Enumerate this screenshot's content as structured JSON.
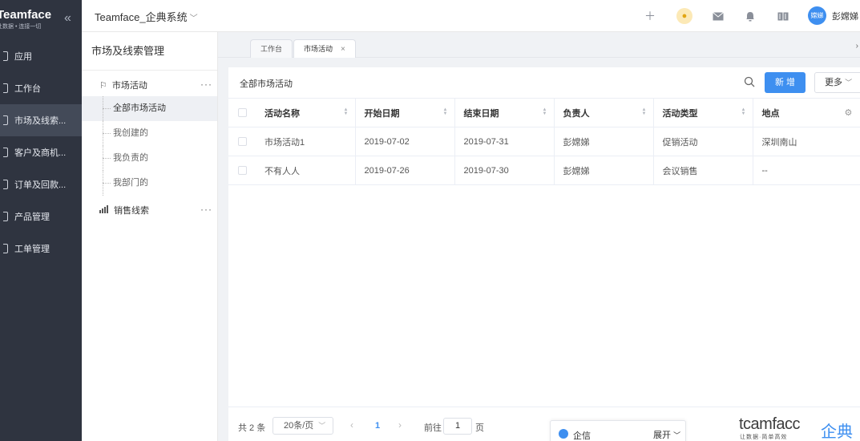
{
  "nav": {
    "brand": "Teamface",
    "slogan": "让数据 • 连接一切",
    "items": [
      {
        "label": "应用",
        "active": false
      },
      {
        "label": "工作台",
        "active": false
      },
      {
        "label": "市场及线索...",
        "active": true
      },
      {
        "label": "客户及商机...",
        "active": false
      },
      {
        "label": "订单及回款...",
        "active": false
      },
      {
        "label": "产品管理",
        "active": false
      },
      {
        "label": "工单管理",
        "active": false
      }
    ]
  },
  "topbar": {
    "title": "Teamface_企典系统",
    "avatar_text": "嫦娣",
    "user_name": "彭嫦娣"
  },
  "subnav": {
    "title": "市场及线索管理",
    "group1": {
      "label": "市场活动",
      "more": "···"
    },
    "leaves": [
      "全部市场活动",
      "我创建的",
      "我负责的",
      "我部门的"
    ],
    "group2": {
      "label": "销售线索",
      "more": "···"
    }
  },
  "tabs": [
    {
      "label": "工作台",
      "closable": false
    },
    {
      "label": "市场活动",
      "closable": true,
      "close": "×"
    }
  ],
  "main": {
    "title": "全部市场活动",
    "new_button": "新 增",
    "more_button": "更多",
    "columns": [
      "活动名称",
      "开始日期",
      "结束日期",
      "负责人",
      "活动类型",
      "地点"
    ],
    "rows": [
      [
        "市场活动1",
        "2019-07-02",
        "2019-07-31",
        "彭嫦娣",
        "促销活动",
        "深圳南山"
      ],
      [
        "不有人人",
        "2019-07-26",
        "2019-07-30",
        "彭嫦娣",
        "会议销售",
        "--"
      ]
    ]
  },
  "pager": {
    "total": "共 2 条",
    "page_size": "20条/页",
    "current_page": "1",
    "goto_label": "前往",
    "goto_value": "1",
    "page_suffix": "页"
  },
  "chat": {
    "name": "企信",
    "expand": "展开"
  },
  "watermark": {
    "en": "tcamfacc",
    "zh": "企典",
    "sub": "让数据·简单高效"
  }
}
